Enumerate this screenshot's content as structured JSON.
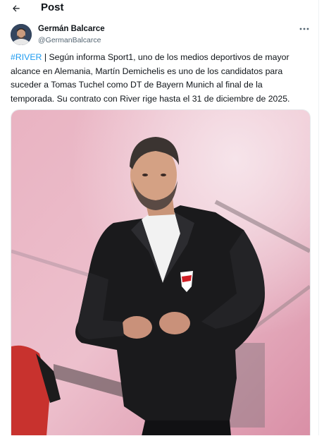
{
  "header": {
    "title": "Post",
    "back_icon": "arrow-left-icon"
  },
  "author": {
    "name": "Germán Balcarce",
    "handle": "@GermanBalcarce",
    "more_icon": "more-horizontal-icon"
  },
  "tweet": {
    "hashtag": "#RIVER",
    "lines": [
      " | Según informa Sport1, uno de los medios deportivos de mayor",
      "alcance en Alemania, Martín Demichelis es uno de los candidatos para",
      "suceder a Tomas Tuchel como DT de Bayern Munich al final de la",
      "temporada. Su contrato con River rige hasta el 31 de diciembre de 2025."
    ]
  },
  "colors": {
    "link": "#1d9bf0",
    "text": "#0f1419",
    "secondary": "#536471"
  }
}
